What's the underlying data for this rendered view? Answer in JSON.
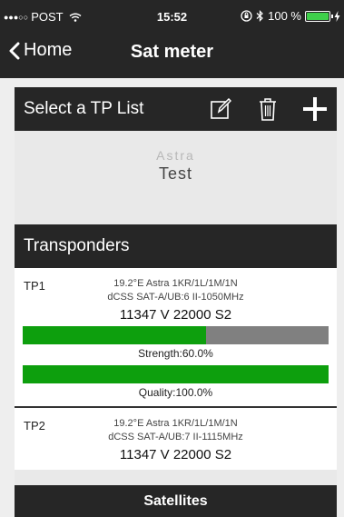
{
  "status": {
    "dots": "●●●○○",
    "carrier": "POST",
    "time": "15:52",
    "battery": "100 %"
  },
  "nav": {
    "back_label": "Home",
    "title": "Sat meter"
  },
  "tp_list": {
    "header": "Select a TP List",
    "picker_faded": "Astra",
    "picker_selected": "Test"
  },
  "transponders": {
    "header": "Transponders",
    "items": [
      {
        "id": "TP1",
        "line1": "19.2°E Astra 1KR/1L/1M/1N",
        "line2": "dCSS SAT-A/UB:6 II-1050MHz",
        "freq": "11347 V 22000 S2",
        "strength_label": "Strength:60.0%",
        "strength": 0.6,
        "quality_label": "Quality:100.0%",
        "quality": 1.0
      },
      {
        "id": "TP2",
        "line1": "19.2°E Astra 1KR/1L/1M/1N",
        "line2": "dCSS SAT-A/UB:7 II-1115MHz",
        "freq": "11347 V 22000 S2"
      }
    ]
  },
  "footer": {
    "satellites_label": "Satellites"
  },
  "colors": {
    "bar_green": "#0d9f0d",
    "bar_gray": "#808080",
    "header_dark": "#262626"
  },
  "icons": [
    "wifi-icon",
    "orientation-lock-icon",
    "bluetooth-icon",
    "battery-icon",
    "charging-icon",
    "chevron-left-icon",
    "edit-icon",
    "trash-icon",
    "plus-icon"
  ]
}
